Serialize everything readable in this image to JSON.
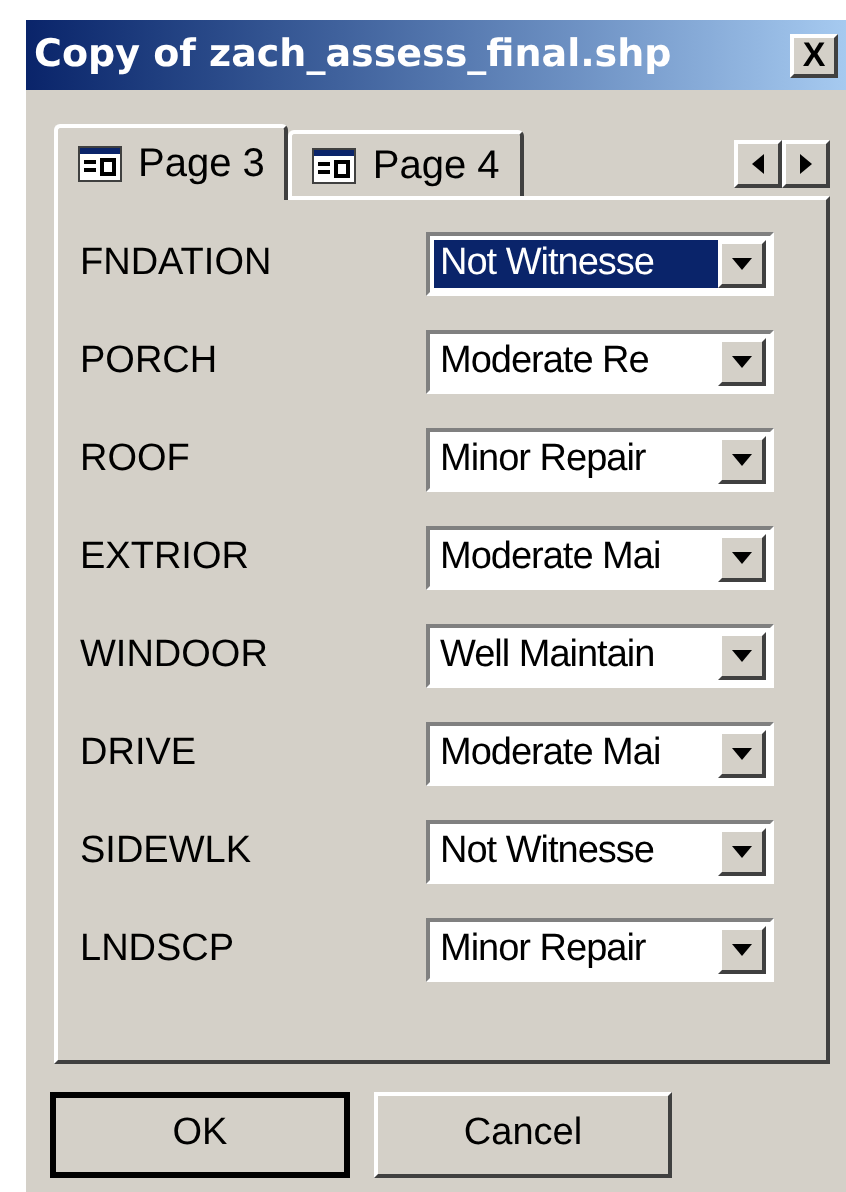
{
  "window": {
    "title": "Copy of zach_assess_final.shp",
    "close_button": "X"
  },
  "tabs": [
    {
      "label": "Page 3",
      "selected": true
    },
    {
      "label": "Page 4",
      "selected": false
    }
  ],
  "fields": [
    {
      "label": "FNDATION",
      "value": "Not Witnesse",
      "focused": true
    },
    {
      "label": "PORCH",
      "value": "Moderate Re",
      "focused": false
    },
    {
      "label": "ROOF",
      "value": "Minor Repair",
      "focused": false
    },
    {
      "label": "EXTRIOR",
      "value": "Moderate Mai",
      "focused": false
    },
    {
      "label": "WINDOOR",
      "value": "Well Maintain",
      "focused": false
    },
    {
      "label": "DRIVE",
      "value": "Moderate Mai",
      "focused": false
    },
    {
      "label": "SIDEWLK",
      "value": "Not Witnesse",
      "focused": false
    },
    {
      "label": "LNDSCP",
      "value": "Minor Repair",
      "focused": false
    }
  ],
  "buttons": [
    {
      "label": "OK",
      "default": true
    },
    {
      "label": "Cancel",
      "default": false
    }
  ]
}
